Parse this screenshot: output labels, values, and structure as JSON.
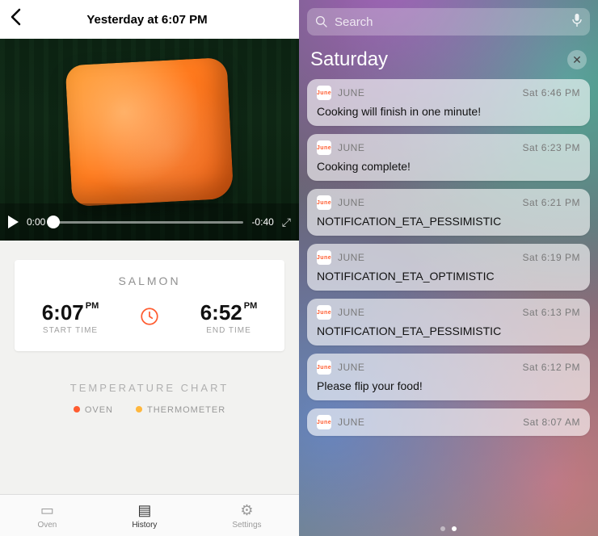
{
  "left": {
    "nav_title": "Yesterday at 6:07 PM",
    "video": {
      "current_time": "0:00",
      "remaining_time": "-0:40"
    },
    "food_label": "SALMON",
    "start": {
      "time": "6:07",
      "suffix": "PM",
      "label": "START TIME"
    },
    "end": {
      "time": "6:52",
      "suffix": "PM",
      "label": "END TIME"
    },
    "temp_title": "TEMPERATURE CHART",
    "legend": {
      "oven": "OVEN",
      "thermometer": "THERMOMETER"
    },
    "tabs": {
      "oven": "Oven",
      "history": "History",
      "settings": "Settings"
    }
  },
  "right": {
    "search_placeholder": "Search",
    "day_label": "Saturday",
    "app_name": "JUNE",
    "icon_text": "June",
    "notifications": [
      {
        "time": "Sat 6:46 PM",
        "message": "Cooking will finish in one minute!"
      },
      {
        "time": "Sat 6:23 PM",
        "message": "Cooking complete!"
      },
      {
        "time": "Sat 6:21 PM",
        "message": "NOTIFICATION_ETA_PESSIMISTIC"
      },
      {
        "time": "Sat 6:19 PM",
        "message": "NOTIFICATION_ETA_OPTIMISTIC"
      },
      {
        "time": "Sat 6:13 PM",
        "message": "NOTIFICATION_ETA_PESSIMISTIC"
      },
      {
        "time": "Sat 6:12 PM",
        "message": "Please flip your food!"
      },
      {
        "time": "Sat 8:07 AM",
        "message": ""
      }
    ]
  },
  "colors": {
    "accent_orange": "#ff5c30",
    "legend_oven": "#ff5c30",
    "legend_thermometer": "#ffb73d"
  }
}
